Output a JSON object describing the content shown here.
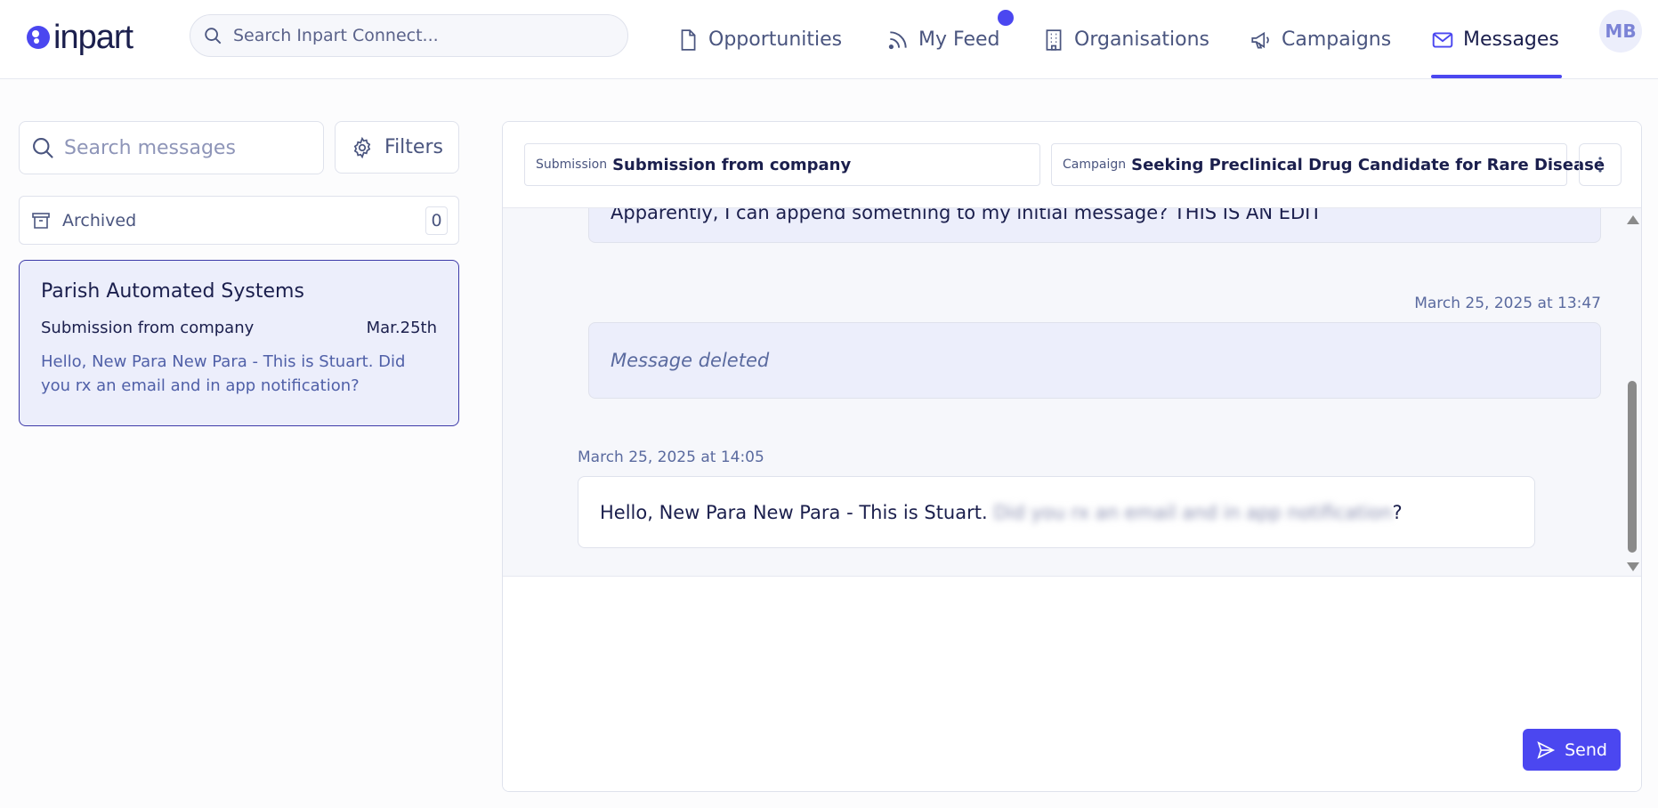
{
  "brand": {
    "name": "inpart",
    "accent": "#4b47f0"
  },
  "header": {
    "search_placeholder": "Search Inpart Connect...",
    "nav": {
      "opportunities": "Opportunities",
      "feed": "My Feed",
      "organisations": "Organisations",
      "campaigns": "Campaigns",
      "messages": "Messages"
    },
    "active_tab": "Messages",
    "avatar_initials": "MB"
  },
  "sidebar": {
    "search_placeholder": "Search messages",
    "filters_label": "Filters",
    "archived_label": "Archived",
    "archived_count": "0",
    "conversations": [
      {
        "title": "Parish Automated Systems",
        "subject": "Submission from company",
        "date": "Mar.25th",
        "preview": "Hello, New Para New Para - This is Stuart. Did you rx an email and in app notification?"
      }
    ]
  },
  "chat": {
    "submission_label": "Submission",
    "submission_value": "Submission from company",
    "campaign_label": "Campaign",
    "campaign_value": "Seeking Preclinical Drug Candidate for Rare Disease",
    "messages": [
      {
        "text": "Apparently, I can append something to my initial message? THIS IS AN EDIT"
      },
      {
        "timestamp": "March 25, 2025 at 13:47",
        "text": "Message deleted"
      },
      {
        "timestamp": "March 25, 2025 at 14:05",
        "text_visible": "Hello, New Para New Para - This is Stuart. ",
        "text_blurred": "Did you rx an email and in app notification",
        "text_end": "?"
      }
    ],
    "send_label": "Send"
  }
}
